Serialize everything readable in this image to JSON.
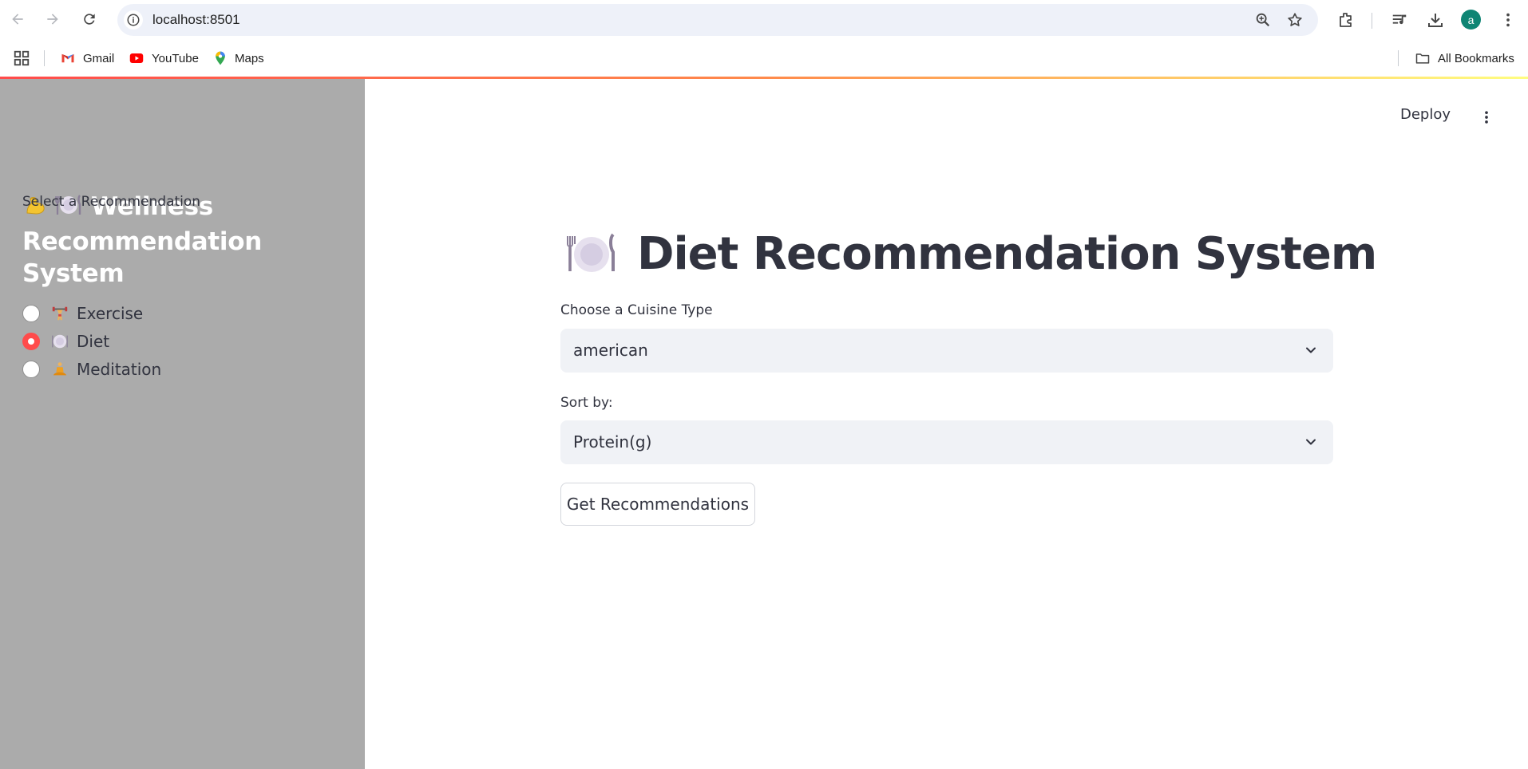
{
  "browser": {
    "url": "localhost:8501",
    "avatar_letter": "a",
    "bookmarks": [
      {
        "label": "Gmail",
        "icon": "gmail-icon"
      },
      {
        "label": "YouTube",
        "icon": "youtube-icon"
      },
      {
        "label": "Maps",
        "icon": "maps-icon"
      }
    ],
    "all_bookmarks_label": "All Bookmarks"
  },
  "header": {
    "deploy_label": "Deploy"
  },
  "sidebar": {
    "title": "💪 🍽️ Wellness Recommendation System",
    "title_icons": [
      "flexed-biceps-icon",
      "plate-icon"
    ],
    "title_text": "Wellness Recommendation System",
    "radio_label": "Select a Recommendation",
    "options": [
      {
        "label": "Exercise",
        "icon": "weightlifter-icon",
        "selected": false
      },
      {
        "label": "Diet",
        "icon": "plate-icon",
        "selected": true
      },
      {
        "label": "Meditation",
        "icon": "meditation-icon",
        "selected": false
      }
    ]
  },
  "main": {
    "title": "Diet Recommendation System",
    "title_icon": "plate-icon",
    "cuisine": {
      "label": "Choose a Cuisine Type",
      "value": "american"
    },
    "sort": {
      "label": "Sort by:",
      "value": "Protein(g)"
    },
    "button_label": "Get Recommendations"
  },
  "colors": {
    "accent": "#ff4b4b",
    "sidebar_bg": "#ababab",
    "select_bg": "#f0f2f6",
    "text": "#31333f"
  }
}
